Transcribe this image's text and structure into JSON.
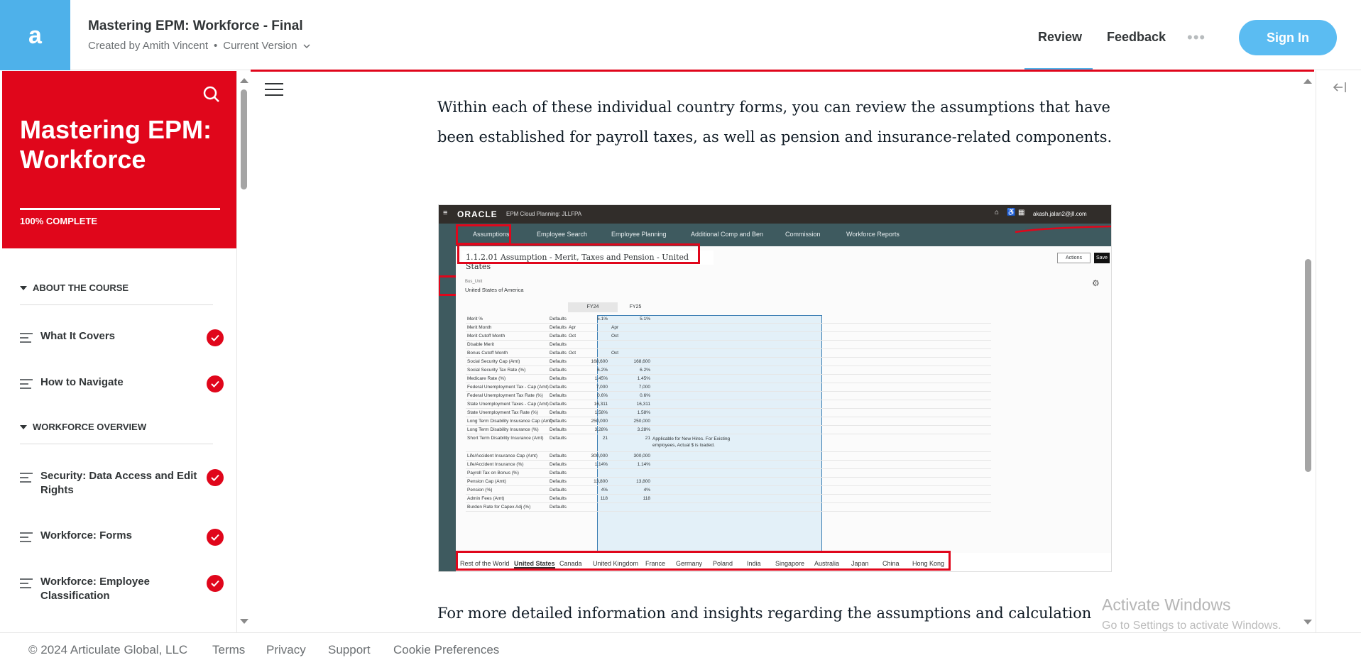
{
  "header": {
    "logo_glyph": "a",
    "title": "Mastering EPM: Workforce - Final",
    "created_by": "Created by Amith Vincent",
    "version": "Current Version",
    "nav_review": "Review",
    "nav_feedback": "Feedback",
    "sign_in": "Sign In",
    "brand_color": "#4eb1ea"
  },
  "sidebar": {
    "title": "Mastering EPM: Workforce",
    "progress_label": "100% COMPLETE",
    "progress_fraction": 1.0,
    "accent_color": "#e0061b",
    "sections": [
      {
        "heading": "ABOUT THE COURSE",
        "lessons": [
          {
            "label": "What It Covers",
            "complete": true
          },
          {
            "label": "How to Navigate",
            "complete": true
          }
        ]
      },
      {
        "heading": "WORKFORCE OVERVIEW",
        "lessons": [
          {
            "label": "Security: Data Access and Edit Rights",
            "complete": true
          },
          {
            "label": "Workforce: Forms",
            "complete": true
          },
          {
            "label": "Workforce: Employee Classification",
            "complete": true
          }
        ]
      }
    ]
  },
  "main": {
    "paragraph_1": "Within each of these individual country forms, you can review the assumptions that have been established for payroll taxes, as well as pension and insurance-related components.",
    "paragraph_2": "For more detailed information and insights regarding the assumptions and calculation"
  },
  "screenshot": {
    "brand": "ORACLE",
    "app": "EPM Cloud Planning: JLLFPA",
    "user": "akash.jalan2@jll.com",
    "tabs": [
      "Assumptions",
      "Employee Search",
      "Employee Planning",
      "Additional Comp and Ben",
      "Commission",
      "Workforce Reports"
    ],
    "form_title": "1.1.2.01 Assumption - Merit, Taxes and Pension - United States",
    "actions_label": "Actions",
    "save_label": "Save",
    "bus_unit_label": "Bus_Unit",
    "bus_unit_value": "United States of America",
    "col_fy24": "FY24",
    "col_fy25": "FY25",
    "rows": [
      {
        "name": "Merit %",
        "src": "Defaults",
        "fy24": "5.1%",
        "fy25": "5.1%",
        "note": ""
      },
      {
        "name": "Merit Month",
        "src": "Defaults",
        "fy24": "Apr",
        "fy25": "Apr",
        "note": ""
      },
      {
        "name": "Merit Cutoff Month",
        "src": "Defaults",
        "fy24": "Oct",
        "fy25": "Oct",
        "note": ""
      },
      {
        "name": "Disable Merit",
        "src": "Defaults",
        "fy24": "",
        "fy25": "",
        "note": ""
      },
      {
        "name": "Bonus Cutoff Month",
        "src": "Defaults",
        "fy24": "Oct",
        "fy25": "Oct",
        "note": ""
      },
      {
        "name": "Social Security Cap (Amt)",
        "src": "Defaults",
        "fy24": "168,600",
        "fy25": "168,600",
        "note": ""
      },
      {
        "name": "Social Security Tax Rate (%)",
        "src": "Defaults",
        "fy24": "6.2%",
        "fy25": "6.2%",
        "note": ""
      },
      {
        "name": "Medicare Rate (%)",
        "src": "Defaults",
        "fy24": "1.45%",
        "fy25": "1.45%",
        "note": ""
      },
      {
        "name": "Federal Unemployment Tax - Cap (Amt)",
        "src": "Defaults",
        "fy24": "7,000",
        "fy25": "7,000",
        "note": ""
      },
      {
        "name": "Federal Unemployment Tax Rate (%)",
        "src": "Defaults",
        "fy24": "0.6%",
        "fy25": "0.6%",
        "note": ""
      },
      {
        "name": "State Unemployment Taxes - Cap (Amt)",
        "src": "Defaults",
        "fy24": "16,311",
        "fy25": "16,311",
        "note": ""
      },
      {
        "name": "State Unemployment Tax Rate (%)",
        "src": "Defaults",
        "fy24": "1.58%",
        "fy25": "1.58%",
        "note": ""
      },
      {
        "name": "Long Term Disability Insurance Cap (Amt)",
        "src": "Defaults",
        "fy24": "250,000",
        "fy25": "250,000",
        "note": ""
      },
      {
        "name": "Long Term Disability Insurance (%)",
        "src": "Defaults",
        "fy24": "3.28%",
        "fy25": "3.28%",
        "note": ""
      },
      {
        "name": "Short Term Disability Insurance (Amt)",
        "src": "Defaults",
        "fy24": "21",
        "fy25": "21",
        "note": "Applicable for New Hires. For Existing employees, Actual $ is loaded."
      },
      {
        "name": "Life/Accident Insurance Cap (Amt)",
        "src": "Defaults",
        "fy24": "300,000",
        "fy25": "300,000",
        "note": ""
      },
      {
        "name": "Life/Accident Insurance (%)",
        "src": "Defaults",
        "fy24": "1.14%",
        "fy25": "1.14%",
        "note": ""
      },
      {
        "name": "Payroll Tax on Bonus (%)",
        "src": "Defaults",
        "fy24": "",
        "fy25": "",
        "note": ""
      },
      {
        "name": "Pension Cap (Amt)",
        "src": "Defaults",
        "fy24": "13,800",
        "fy25": "13,800",
        "note": ""
      },
      {
        "name": "Pension (%)",
        "src": "Defaults",
        "fy24": "4%",
        "fy25": "4%",
        "note": ""
      },
      {
        "name": "Admin Fees (Amt)",
        "src": "Defaults",
        "fy24": "118",
        "fy25": "118",
        "note": ""
      },
      {
        "name": "Burden Rate for Capex Adj (%)",
        "src": "Defaults",
        "fy24": "",
        "fy25": "",
        "note": ""
      }
    ],
    "countries": [
      "Rest of the World",
      "United States",
      "Canada",
      "United Kingdom",
      "France",
      "Germany",
      "Poland",
      "India",
      "Singapore",
      "Australia",
      "Japan",
      "China",
      "Hong Kong"
    ]
  },
  "footer": {
    "copyright": "© 2024 Articulate Global, LLC",
    "terms": "Terms",
    "privacy": "Privacy",
    "support": "Support",
    "cookies": "Cookie Preferences"
  },
  "watermark": {
    "line1": "Activate Windows",
    "line2": "Go to Settings to activate Windows."
  }
}
